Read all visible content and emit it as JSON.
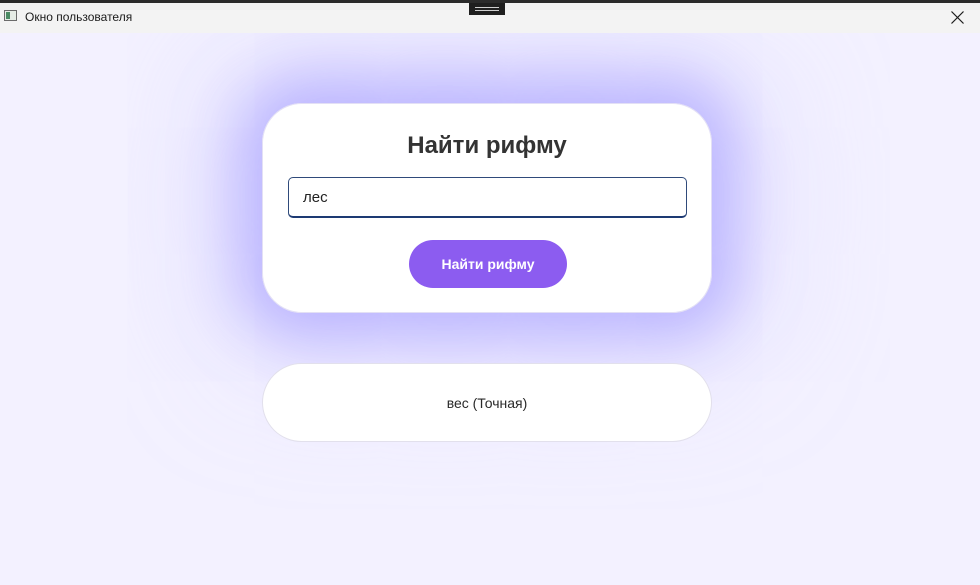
{
  "window": {
    "title": "Окно пользователя",
    "icon": "app-window-icon"
  },
  "search_card": {
    "title": "Найти рифму",
    "input_value": "лес",
    "button_label": "Найти рифму"
  },
  "results": [
    {
      "text": "вес (Точная)"
    }
  ],
  "colors": {
    "background": "#f3f1ff",
    "accent": "#8c5cf0",
    "glow": "#968cff"
  }
}
